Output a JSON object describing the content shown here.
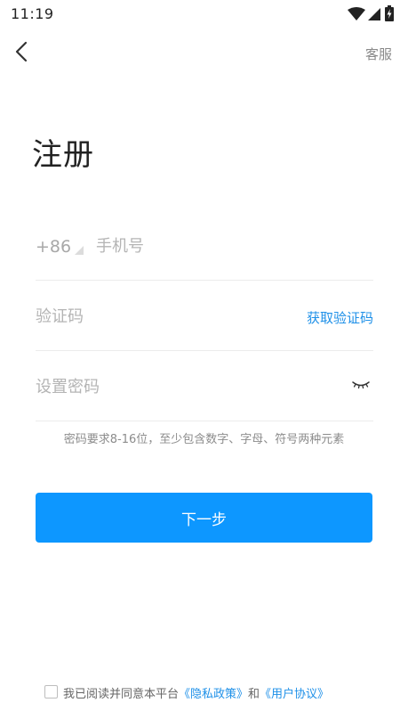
{
  "status_bar": {
    "time": "11:19",
    "icons": [
      "wifi-icon",
      "signal-icon",
      "battery-charging-icon"
    ]
  },
  "nav": {
    "back_icon": "chevron-left-icon",
    "service_label": "客服"
  },
  "title": "注册",
  "form": {
    "country_code": "+86",
    "phone_placeholder": "手机号",
    "code_placeholder": "验证码",
    "get_code_label": "获取验证码",
    "password_placeholder": "设置密码",
    "eye_icon": "eye-closed-icon"
  },
  "password_hint": "密码要求8-16位，至少包含数字、字母、符号两种元素",
  "next_label": "下一步",
  "agreement": {
    "checked": false,
    "prefix": "我已阅读并同意本平台",
    "privacy_link": "《隐私政策》",
    "connector": "和",
    "user_link": "《用户协议》"
  },
  "colors": {
    "accent": "#0d97ff",
    "link": "#1e90e8",
    "placeholder": "#b4b4b4",
    "divider": "#ececec"
  }
}
